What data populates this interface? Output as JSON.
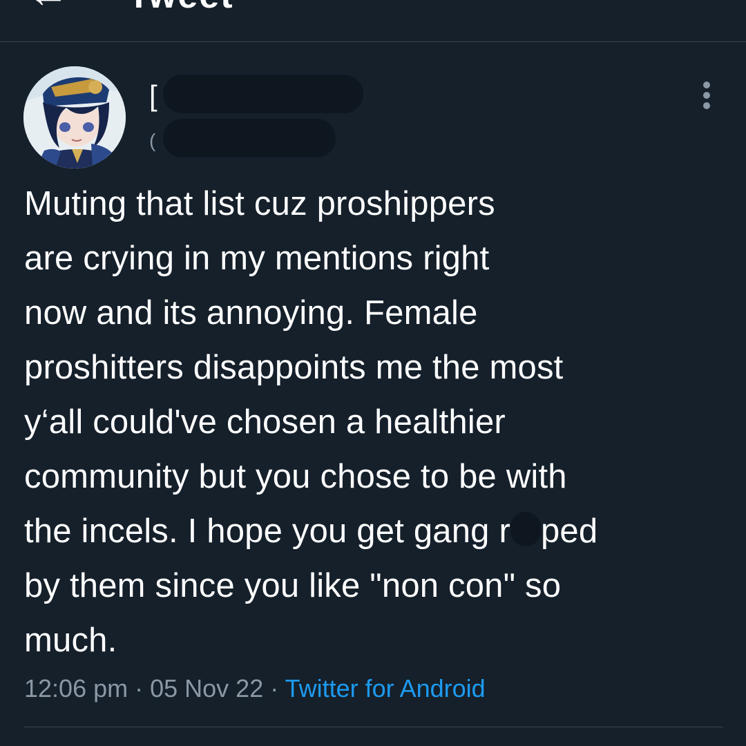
{
  "topbar": {
    "back_icon": "arrow-left-icon",
    "title": "Tweet"
  },
  "author": {
    "avatar_icon": "anime-character-avatar",
    "name_visible": "[",
    "handle_visible": "(",
    "more_icon": "more-vertical-icon"
  },
  "tweet": {
    "lines": [
      "Muting that list cuz proshippers",
      "are crying in my mentions right",
      "now and its annoying. Female",
      "proshitters disappoints me the most",
      "y‘all could've chosen a healthier",
      "community but you chose to be with",
      "by them since you like \"non con\" so",
      "much."
    ],
    "line7_before": "the incels. I hope you get gang r",
    "line7_after": "ped"
  },
  "meta": {
    "time": "12:06 pm",
    "sep1": " · ",
    "date": "05 Nov 22",
    "sep2": " · ",
    "source": "Twitter for Android"
  },
  "colors": {
    "background": "#15202b",
    "text": "#ffffff",
    "muted": "#8b98a5",
    "link": "#1d9bf0",
    "redaction": "#0e1720"
  }
}
